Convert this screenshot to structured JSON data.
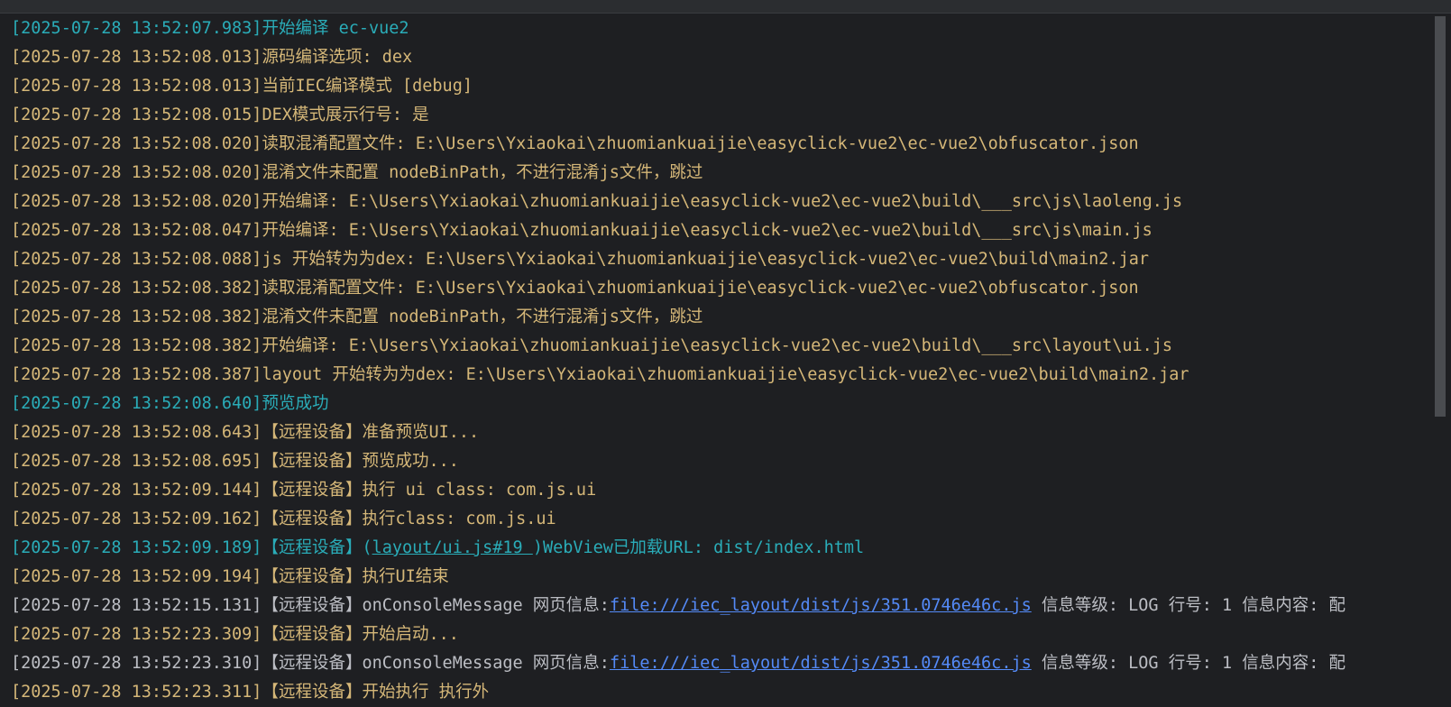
{
  "colors": {
    "background": "#1e1f22",
    "log_yellow": "#d5b778",
    "log_teal": "#2aacb8",
    "log_gray": "#bcbec4",
    "link_blue": "#548af7"
  },
  "log": [
    {
      "ts": "[2025-07-28 13:52:07.983]",
      "msg": "开始编译 ec-vue2",
      "color": "teal"
    },
    {
      "ts": "[2025-07-28 13:52:08.013]",
      "msg": "源码编译选项: dex",
      "color": "yellow"
    },
    {
      "ts": "[2025-07-28 13:52:08.013]",
      "msg": "当前IEC编译模式 [debug]",
      "color": "yellow"
    },
    {
      "ts": "[2025-07-28 13:52:08.015]",
      "msg": "DEX模式展示行号: 是",
      "color": "yellow"
    },
    {
      "ts": "[2025-07-28 13:52:08.020]",
      "msg": "读取混淆配置文件: E:\\Users\\Yxiaokai\\zhuomiankuaijie\\easyclick-vue2\\ec-vue2\\obfuscator.json",
      "color": "yellow"
    },
    {
      "ts": "[2025-07-28 13:52:08.020]",
      "msg": "混淆文件未配置 nodeBinPath，不进行混淆js文件，跳过",
      "color": "yellow"
    },
    {
      "ts": "[2025-07-28 13:52:08.020]",
      "msg": "开始编译: E:\\Users\\Yxiaokai\\zhuomiankuaijie\\easyclick-vue2\\ec-vue2\\build\\___src\\js\\laoleng.js",
      "color": "yellow"
    },
    {
      "ts": "[2025-07-28 13:52:08.047]",
      "msg": "开始编译: E:\\Users\\Yxiaokai\\zhuomiankuaijie\\easyclick-vue2\\ec-vue2\\build\\___src\\js\\main.js",
      "color": "yellow"
    },
    {
      "ts": "[2025-07-28 13:52:08.088]",
      "msg": "js 开始转为为dex: E:\\Users\\Yxiaokai\\zhuomiankuaijie\\easyclick-vue2\\ec-vue2\\build\\main2.jar",
      "color": "yellow"
    },
    {
      "ts": "[2025-07-28 13:52:08.382]",
      "msg": "读取混淆配置文件: E:\\Users\\Yxiaokai\\zhuomiankuaijie\\easyclick-vue2\\ec-vue2\\obfuscator.json",
      "color": "yellow"
    },
    {
      "ts": "[2025-07-28 13:52:08.382]",
      "msg": "混淆文件未配置 nodeBinPath，不进行混淆js文件，跳过",
      "color": "yellow"
    },
    {
      "ts": "[2025-07-28 13:52:08.382]",
      "msg": "开始编译: E:\\Users\\Yxiaokai\\zhuomiankuaijie\\easyclick-vue2\\ec-vue2\\build\\___src\\layout\\ui.js",
      "color": "yellow"
    },
    {
      "ts": "[2025-07-28 13:52:08.387]",
      "msg": "layout 开始转为为dex: E:\\Users\\Yxiaokai\\zhuomiankuaijie\\easyclick-vue2\\ec-vue2\\build\\main2.jar",
      "color": "yellow"
    },
    {
      "ts": "[2025-07-28 13:52:08.640]",
      "msg": "预览成功",
      "color": "teal"
    },
    {
      "ts": "[2025-07-28 13:52:08.643]",
      "msg": "【远程设备】准备预览UI...",
      "color": "yellow"
    },
    {
      "ts": "[2025-07-28 13:52:08.695]",
      "msg": "【远程设备】预览成功...",
      "color": "yellow"
    },
    {
      "ts": "[2025-07-28 13:52:09.144]",
      "msg": "【远程设备】执行 ui class: com.js.ui",
      "color": "yellow"
    },
    {
      "ts": "[2025-07-28 13:52:09.162]",
      "msg": "【远程设备】执行class: com.js.ui",
      "color": "yellow"
    },
    {
      "ts": "[2025-07-28 13:52:09.189]",
      "pre": "【远程设备】(",
      "link": "layout/ui.js#19 ",
      "post": ")WebView已加载URL: dist/index.html",
      "color": "teal"
    },
    {
      "ts": "[2025-07-28 13:52:09.194]",
      "msg": "【远程设备】执行UI结束",
      "color": "yellow"
    },
    {
      "ts": "[2025-07-28 13:52:15.131]",
      "pre": "【远程设备】onConsoleMessage 网页信息:",
      "link": "file:///iec_layout/dist/js/351.0746e46c.js",
      "post": " 信息等级: LOG 行号: 1 信息内容: 配",
      "color": "gray"
    },
    {
      "ts": "[2025-07-28 13:52:23.309]",
      "msg": "【远程设备】开始启动...",
      "color": "yellow"
    },
    {
      "ts": "[2025-07-28 13:52:23.310]",
      "pre": "【远程设备】onConsoleMessage 网页信息:",
      "link": "file:///iec_layout/dist/js/351.0746e46c.js",
      "post": " 信息等级: LOG 行号: 1 信息内容: 配",
      "color": "gray"
    },
    {
      "ts": "[2025-07-28 13:52:23.311]",
      "msg": "【远程设备】开始执行 执行外",
      "color": "yellow"
    }
  ]
}
